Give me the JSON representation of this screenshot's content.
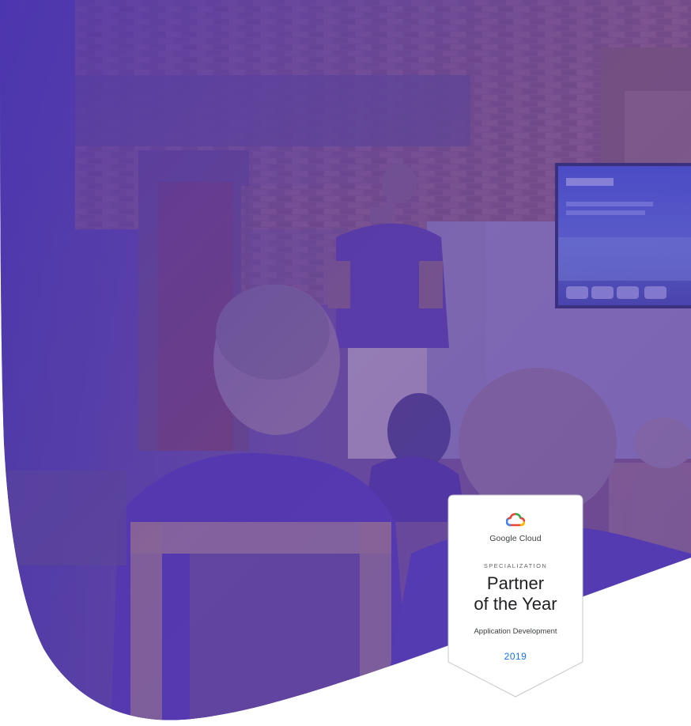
{
  "badge": {
    "brand": "Google Cloud",
    "specialization": "SPECIALIZATION",
    "title_line1": "Partner",
    "title_line2": "of the Year",
    "category": "Application Development",
    "year": "2019"
  },
  "colors": {
    "purple_overlay": "#5b3fb0",
    "purple_dark": "#3e2a8e",
    "brick": "#8a5a6e",
    "accent_blue": "#1a73e8"
  },
  "icons": {
    "logo": "google-cloud-logo-icon"
  }
}
